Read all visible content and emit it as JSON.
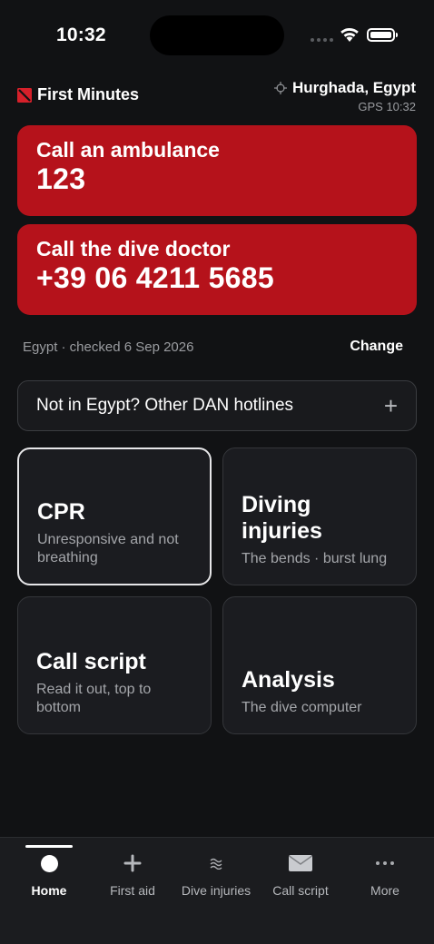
{
  "status_bar": {
    "time": "10:32"
  },
  "header": {
    "brand": "First Minutes",
    "location": "Hurghada, Egypt",
    "gps": "GPS 10:32"
  },
  "calls": [
    {
      "title": "Call an ambulance",
      "number": "123"
    },
    {
      "title": "Call the dive doctor",
      "number": "+39 06 4211 5685"
    }
  ],
  "country_check": {
    "text": "Egypt · checked 6 Sep 2026",
    "change_label": "Change"
  },
  "hotlines": {
    "label": "Not in Egypt? Other DAN hotlines"
  },
  "tiles": [
    {
      "title": "CPR",
      "subtitle": "Unresponsive and not breathing"
    },
    {
      "title": "Diving injuries",
      "subtitle": "The bends · burst lung"
    },
    {
      "title": "Call script",
      "subtitle": "Read it out, top to bottom"
    },
    {
      "title": "Analysis",
      "subtitle": "The dive computer"
    }
  ],
  "tabs": [
    {
      "label": "Home",
      "icon": "home-dot-icon"
    },
    {
      "label": "First aid",
      "icon": "plus-icon"
    },
    {
      "label": "Dive injuries",
      "icon": "waves-icon"
    },
    {
      "label": "Call script",
      "icon": "envelope-icon"
    },
    {
      "label": "More",
      "icon": "ellipsis-icon"
    }
  ],
  "colors": {
    "accent_red": "#b5121b",
    "background": "#111214",
    "tile": "#1b1c20"
  }
}
